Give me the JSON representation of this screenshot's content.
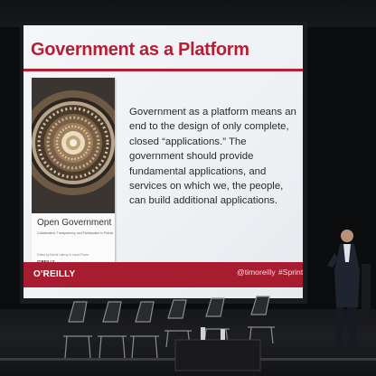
{
  "slide": {
    "title": "Government as a Platform",
    "body": "Government as a platform means an end to the design of only complete, closed “applications.” The government should provide fundamental applications, and services on which we, the people, can build additional applications.",
    "book": {
      "title": "Open Government",
      "subtitle": "Collaboration, Transparency, and Participation in Practice",
      "editors": "Edited by Daniel Lathrop & Laurel Ruma",
      "publisher": "O'REILLY"
    },
    "footer": {
      "logo": "O'REILLY",
      "handle": "@timoreilly",
      "hashtag": "#Sprint"
    }
  },
  "colors": {
    "accent": "#b41f35",
    "footer": "#a81c30",
    "background": "#0b0c0e"
  }
}
